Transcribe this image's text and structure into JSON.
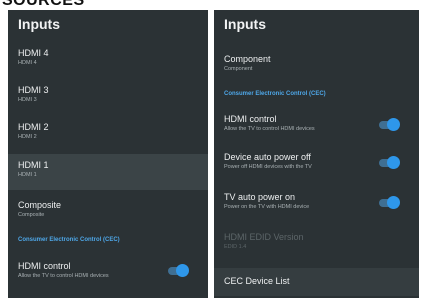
{
  "header": {
    "title": "SOURCES"
  },
  "left_panel": {
    "title": "Inputs",
    "items": [
      {
        "label": "HDMI 4",
        "sub": "HDMI 4"
      },
      {
        "label": "HDMI 3",
        "sub": "HDMI 3"
      },
      {
        "label": "HDMI 2",
        "sub": "HDMI 2"
      },
      {
        "label": "HDMI 1",
        "sub": "HDMI 1"
      },
      {
        "label": "Composite",
        "sub": "Composite"
      }
    ],
    "section": "Consumer Electronic Control (CEC)",
    "toggle_item": {
      "label": "HDMI control",
      "sub": "Allow the TV to control HDMI devices",
      "state": "on"
    }
  },
  "right_panel": {
    "title": "Inputs",
    "component": {
      "label": "Component",
      "sub": "Component"
    },
    "section": "Consumer Electronic Control (CEC)",
    "toggles": [
      {
        "label": "HDMI control",
        "sub": "Allow the TV to control HDMI devices",
        "state": "on"
      },
      {
        "label": "Device auto power off",
        "sub": "Power off HDMI devices with the TV",
        "state": "on"
      },
      {
        "label": "TV auto power on",
        "sub": "Power on the TV with HDMI device",
        "state": "on"
      }
    ],
    "disabled_item": {
      "label": "HDMI EDID Version",
      "sub": "EDID 1.4"
    },
    "cec_list": {
      "label": "CEC Device List"
    }
  },
  "colors": {
    "panel_bg": "#2b3235",
    "selected_bg": "#3b4447",
    "accent": "#2e97ea",
    "section_text": "#4ea7e8"
  }
}
